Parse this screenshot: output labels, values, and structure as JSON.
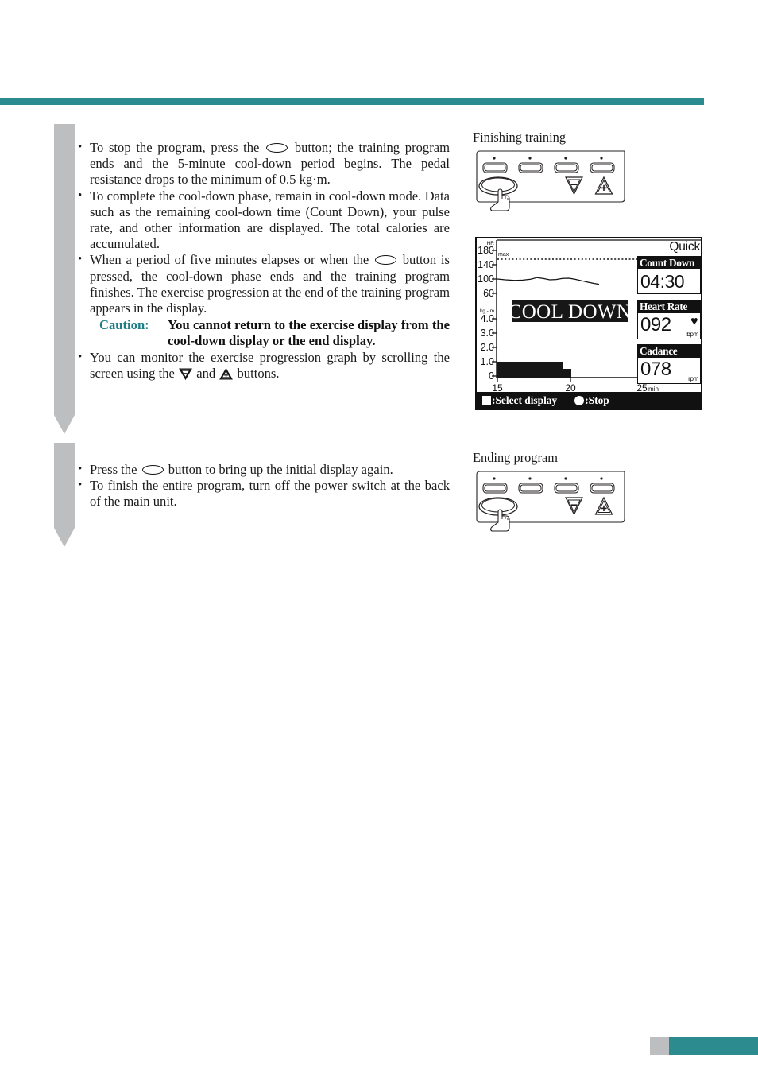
{
  "page": {
    "accent_color": "#2b8b8f",
    "ribbon_color": "#bcbec0"
  },
  "body": {
    "block1": {
      "b1_pre": "To stop the program, press the",
      "b1_post": "button; the training program ends and the 5-minute cool-down period begins. The pedal resistance drops to the minimum of 0.5 kg·m.",
      "b2": "To complete the cool-down phase, remain in cool-down mode. Data such as the remaining cool-down time (Count Down), your pulse rate, and other information are displayed. The total calories are accumulated.",
      "b3_pre": "When a period of five minutes elapses or when the",
      "b3_post": "button is pressed, the cool-down phase ends and the training program finishes. The exercise progression at the end of the training program appears in the display.",
      "caution_label": "Caution:",
      "caution_text": "You cannot return to the exercise display from the cool-down display or the end display.",
      "b4_pre": "You can monitor the exercise progression graph by scrolling the screen using the",
      "b4_mid": "and",
      "b4_post": "buttons."
    },
    "block2": {
      "b1_pre": "Press the",
      "b1_post": "button to bring up the initial display again.",
      "b2": "To finish the entire program, turn off the power switch at the back of the main unit."
    }
  },
  "right": {
    "label_finishing": "Finishing training",
    "label_ending": "Ending program"
  },
  "lcd": {
    "mode": "Quick",
    "count_down": {
      "caption": "Count Down",
      "value": "04:30",
      "unit": ""
    },
    "heart_rate": {
      "caption": "Heart Rate",
      "value": "092",
      "unit": "bpm",
      "icon": "heart-icon"
    },
    "cadence": {
      "caption": "Cadance",
      "value": "078",
      "unit": "rpm"
    },
    "overlay_text": "COOL DOWN",
    "legend": {
      "select_display": ":Select display",
      "stop": ":Stop"
    }
  },
  "chart_data": {
    "type": "line",
    "title": "",
    "xlabel": "min",
    "x_ticks": [
      "15",
      "20",
      "25"
    ],
    "xlim": [
      15,
      25
    ],
    "grid": false,
    "legend_position": "none",
    "annotations": [
      {
        "text": "max",
        "y": 160,
        "style": "dotted-line"
      },
      {
        "text": "COOL DOWN",
        "style": "inverse-banner"
      }
    ],
    "axes": [
      {
        "name": "HR",
        "ylabel": "HR",
        "y_ticks": [
          180,
          140,
          100,
          60
        ],
        "ylim": [
          40,
          195
        ],
        "series": [
          {
            "name": "heart rate",
            "type": "line",
            "x": [
              15.0,
              15.6,
              16.2,
              16.8,
              17.4,
              18.0,
              18.5,
              19.0,
              19.5,
              20.0,
              20.4
            ],
            "values": [
              99,
              97,
              96,
              97,
              101,
              98,
              97,
              100,
              99,
              94,
              90
            ]
          }
        ]
      },
      {
        "name": "load",
        "ylabel": "kg - m",
        "y_ticks": [
          4.0,
          3.0,
          2.0,
          1.0,
          0
        ],
        "ylim": [
          0,
          4.4
        ],
        "series": [
          {
            "name": "pedal load",
            "type": "bar",
            "x": [
              15,
              20.2,
              20.2,
              20.6
            ],
            "values": [
              1.0,
              1.0,
              0.5,
              0.5
            ]
          }
        ]
      }
    ]
  }
}
